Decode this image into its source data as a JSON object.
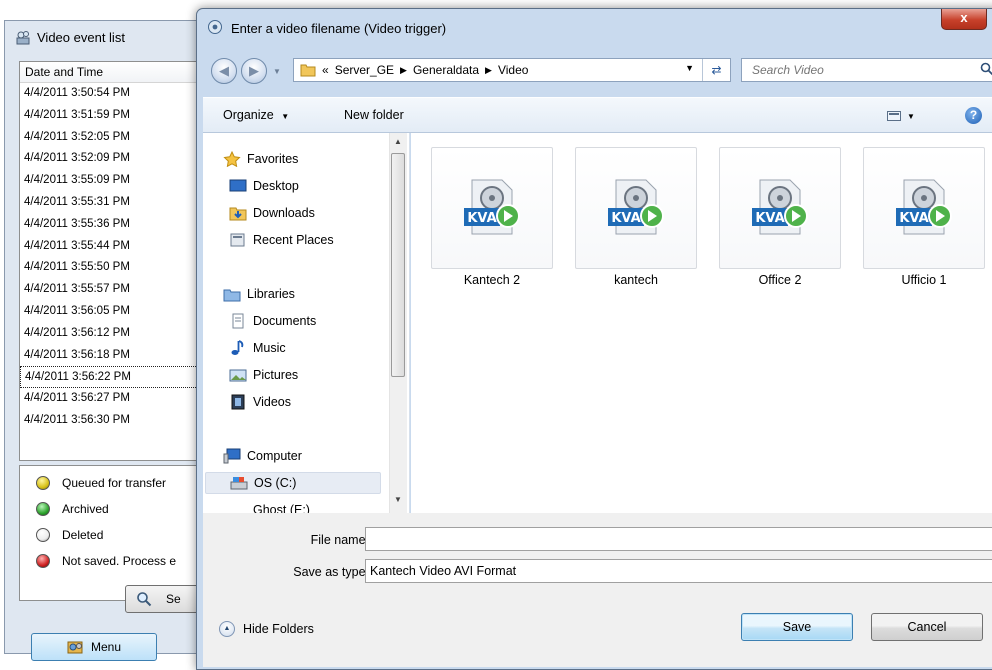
{
  "background_window": {
    "title": "Video event list",
    "list_header": "Date and Time",
    "events": [
      "4/4/2011 3:50:54 PM",
      "4/4/2011 3:51:59 PM",
      "4/4/2011 3:52:05 PM",
      "4/4/2011 3:52:09 PM",
      "4/4/2011 3:55:09 PM",
      "4/4/2011 3:55:31 PM",
      "4/4/2011 3:55:36 PM",
      "4/4/2011 3:55:44 PM",
      "4/4/2011 3:55:50 PM",
      "4/4/2011 3:55:57 PM",
      "4/4/2011 3:56:05 PM",
      "4/4/2011 3:56:12 PM",
      "4/4/2011 3:56:18 PM",
      "4/4/2011 3:56:22 PM",
      "4/4/2011 3:56:27 PM",
      "4/4/2011 3:56:30 PM"
    ],
    "selected_event": "4/4/2011 3:56:22 PM",
    "legend": [
      {
        "label": "Queued for transfer",
        "color": "#d8c21a"
      },
      {
        "label": "Archived",
        "color": "#2fa52f"
      },
      {
        "label": "Deleted",
        "color": "#ffffff"
      },
      {
        "label": "Not saved. Process e",
        "color": "#d02424"
      }
    ],
    "search_button_partial": "Se",
    "menu_button": "Menu"
  },
  "dialog": {
    "title": "Enter a video filename (Video trigger)",
    "close_glyph": "x",
    "address": {
      "prefix": "«",
      "segments": [
        "Server_GE",
        "Generaldata",
        "Video"
      ]
    },
    "search_placeholder": "Search Video",
    "toolbar": {
      "organize": "Organize",
      "new_folder": "New folder",
      "help_glyph": "?"
    },
    "nav": {
      "favorites": "Favorites",
      "desktop": "Desktop",
      "downloads": "Downloads",
      "recent_places": "Recent Places",
      "libraries": "Libraries",
      "documents": "Documents",
      "music": "Music",
      "pictures": "Pictures",
      "videos": "Videos",
      "computer": "Computer",
      "os_drive": "OS (C:)",
      "cut_item": "Ghost (E:)"
    },
    "files": [
      {
        "name": "Kantech 2",
        "badge": "KVA"
      },
      {
        "name": "kantech",
        "badge": "KVA"
      },
      {
        "name": "Office 2",
        "badge": "KVA"
      },
      {
        "name": "Ufficio 1",
        "badge": "KVA"
      }
    ],
    "file_name_label": "File name:",
    "file_name_value": "",
    "save_as_label": "Save as type:",
    "save_as_value": "Kantech Video AVI Format",
    "hide_folders": "Hide Folders",
    "save": "Save",
    "cancel": "Cancel"
  }
}
